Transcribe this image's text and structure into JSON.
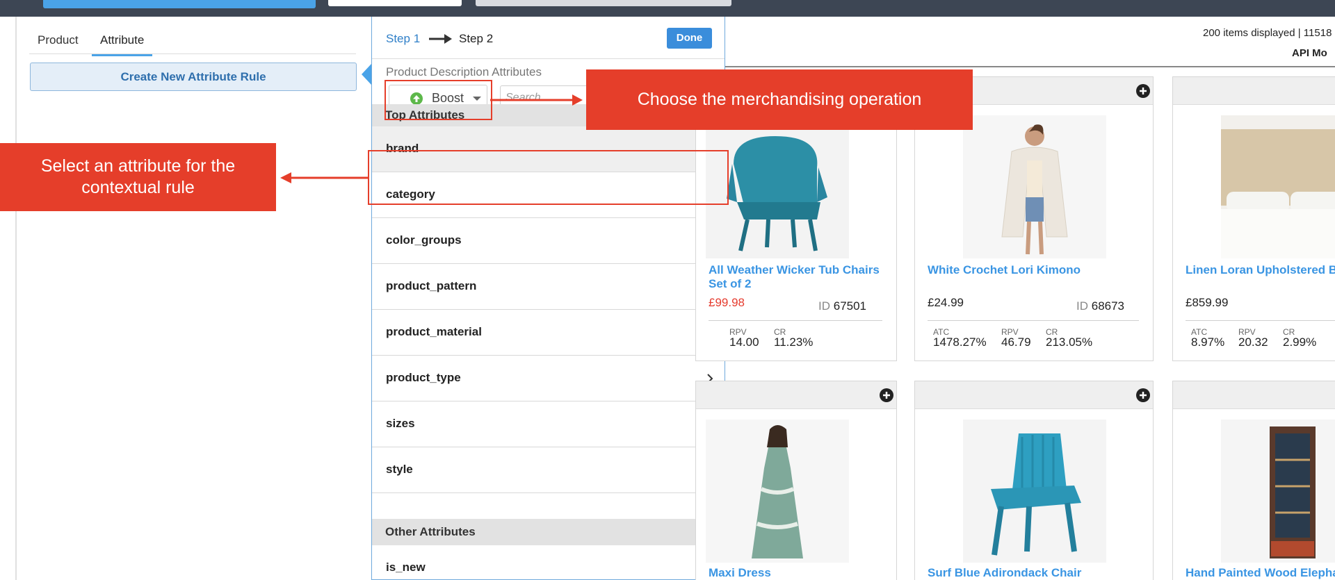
{
  "left_panel": {
    "tabs": [
      "Product",
      "Attribute"
    ],
    "create_button": "Create New Attribute Rule"
  },
  "popover": {
    "step1": "Step 1",
    "step2": "Step 2",
    "done": "Done",
    "section_label": "Product Description Attributes",
    "operation": "Boost",
    "search_placeholder": "Search",
    "top_header": "Top Attributes",
    "top_attributes": [
      "brand",
      "category",
      "color_groups",
      "product_pattern",
      "product_material",
      "product_type",
      "sizes",
      "style"
    ],
    "other_header": "Other Attributes",
    "other_attributes": [
      "is_new"
    ]
  },
  "results": {
    "items_count": "200 items displayed | 11518",
    "api_mode": "API Mo"
  },
  "products": [
    {
      "name": "All Weather Wicker Tub Chairs Set of 2",
      "price": "£99.98",
      "price_sale": true,
      "id_label": "ID",
      "id": "67501",
      "metrics": [
        {
          "label": "RPV",
          "value": "14.00"
        },
        {
          "label": "CR",
          "value": "11.23%"
        }
      ]
    },
    {
      "name": "White Crochet Lori Kimono",
      "price": "£24.99",
      "price_sale": false,
      "id_label": "ID",
      "id": "68673",
      "metrics": [
        {
          "label": "ATC",
          "value": "1478.27%"
        },
        {
          "label": "RPV",
          "value": "46.79"
        },
        {
          "label": "CR",
          "value": "213.05%"
        }
      ]
    },
    {
      "name": "Linen Loran Upholstered B",
      "price": "£859.99",
      "price_sale": false,
      "metrics": [
        {
          "label": "ATC",
          "value": "8.97%"
        },
        {
          "label": "RPV",
          "value": "20.32"
        },
        {
          "label": "CR",
          "value": "2.99%"
        }
      ]
    },
    {
      "name": "Maxi Dress"
    },
    {
      "name": "Surf Blue Adirondack Chair"
    },
    {
      "name": "Hand Painted Wood Elepha"
    }
  ],
  "annotations": {
    "operation_callout": "Choose the merchandising operation",
    "attribute_callout_line1": "Select an attribute for the",
    "attribute_callout_line2": "contextual rule"
  },
  "colors": {
    "accent": "#4aa3e8",
    "link": "#3a95e3",
    "callout": "#e53e2a",
    "sale_price": "#e53b2e",
    "topbar": "#3d4654"
  }
}
